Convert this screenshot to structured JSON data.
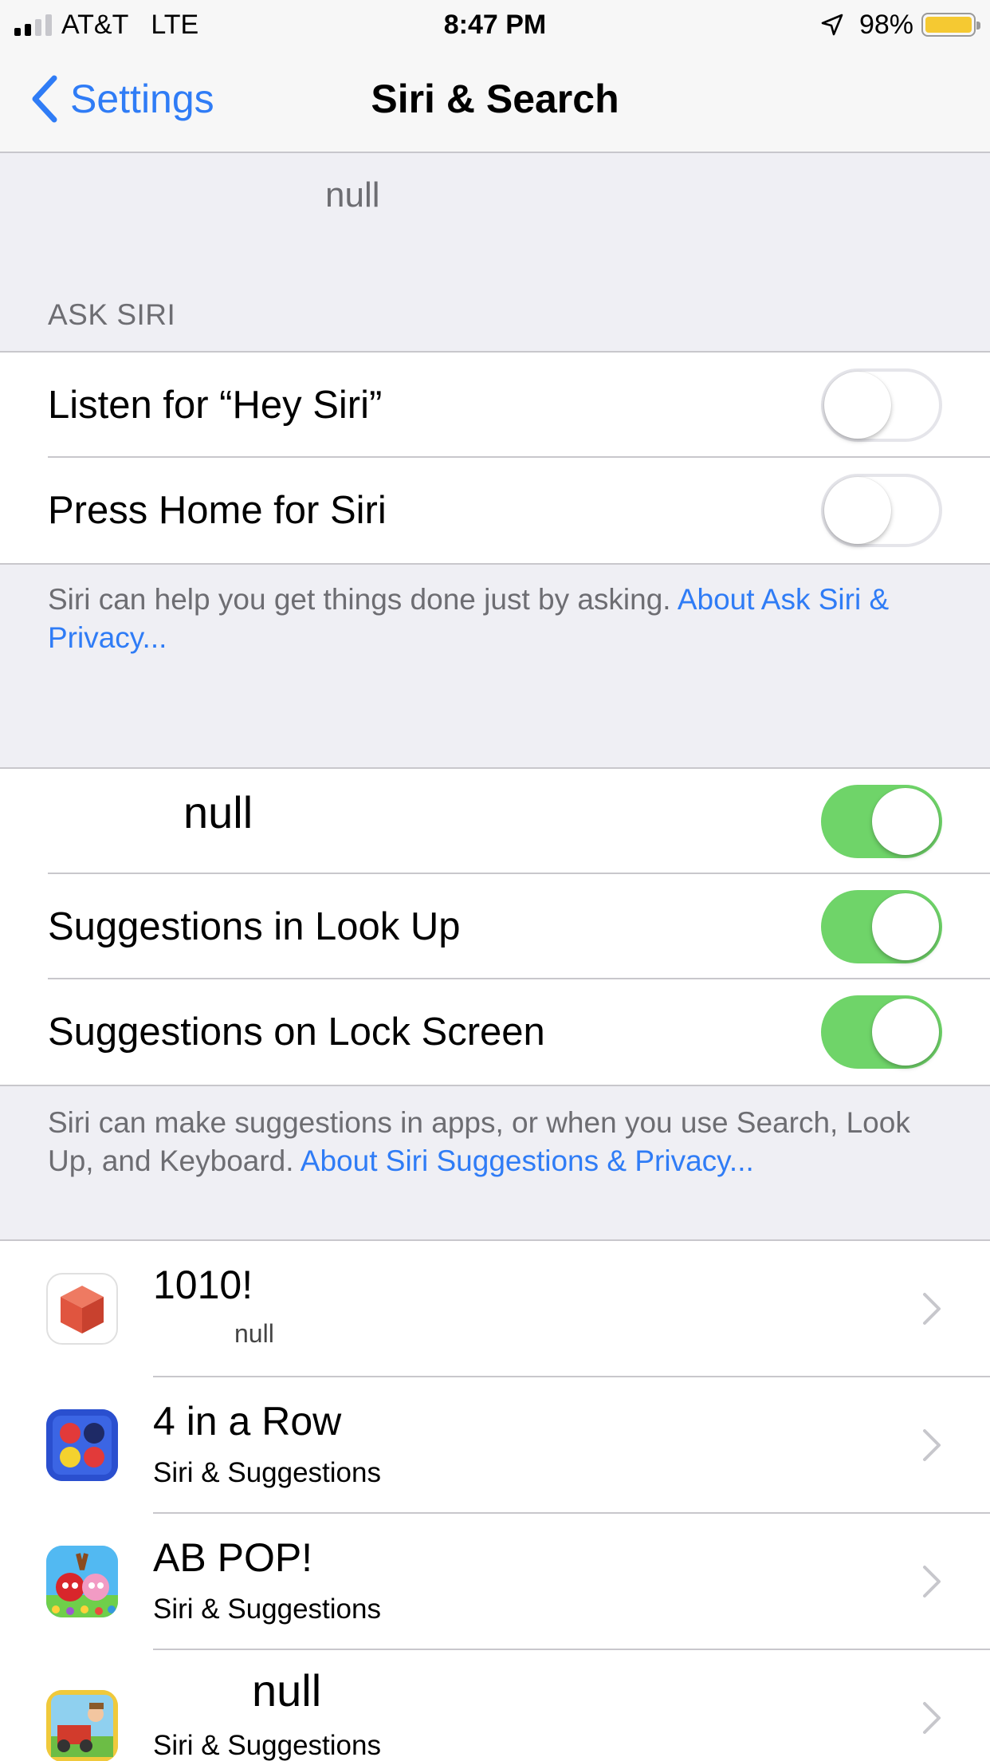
{
  "status_bar": {
    "carrier": "AT&T",
    "network": "LTE",
    "time": "8:47 PM",
    "battery_percent": "98%",
    "signal_bars_filled": 2,
    "signal_bars_total": 4,
    "icons": [
      "signal-icon",
      "location-arrow-icon",
      "battery-icon"
    ]
  },
  "nav": {
    "back_label": "Settings",
    "title": "Siri & Search"
  },
  "top_placeholder": "null",
  "ask_siri": {
    "header": "ASK SIRI",
    "rows": [
      {
        "label": "Listen for “Hey Siri”",
        "on": false
      },
      {
        "label": "Press Home for Siri",
        "on": false
      }
    ],
    "footer": "Siri can help you get things done just by asking.",
    "footer_link": "About Ask Siri & Privacy..."
  },
  "suggestions": {
    "rows": [
      {
        "label": "null",
        "on": true
      },
      {
        "label": "Suggestions in Look Up",
        "on": true
      },
      {
        "label": "Suggestions on Lock Screen",
        "on": true
      }
    ],
    "footer": "Siri can make suggestions in apps, or when you use Search, Look Up, and Keyboard.",
    "footer_link": "About Siri Suggestions & Privacy..."
  },
  "apps": [
    {
      "name": "1010!",
      "subtitle": "null",
      "icon": "cube-app-icon"
    },
    {
      "name": "4 in a Row",
      "subtitle": "Siri & Suggestions",
      "icon": "four-in-a-row-app-icon"
    },
    {
      "name": "AB POP!",
      "subtitle": "Siri & Suggestions",
      "icon": "angry-birds-pop-app-icon"
    },
    {
      "name": "null",
      "subtitle": "Siri & Suggestions",
      "icon": "farm-game-app-icon"
    }
  ],
  "colors": {
    "accent": "#2f7cf6",
    "toggle_on": "#6fd469",
    "background": "#efeff4",
    "battery": "#f5c932"
  }
}
